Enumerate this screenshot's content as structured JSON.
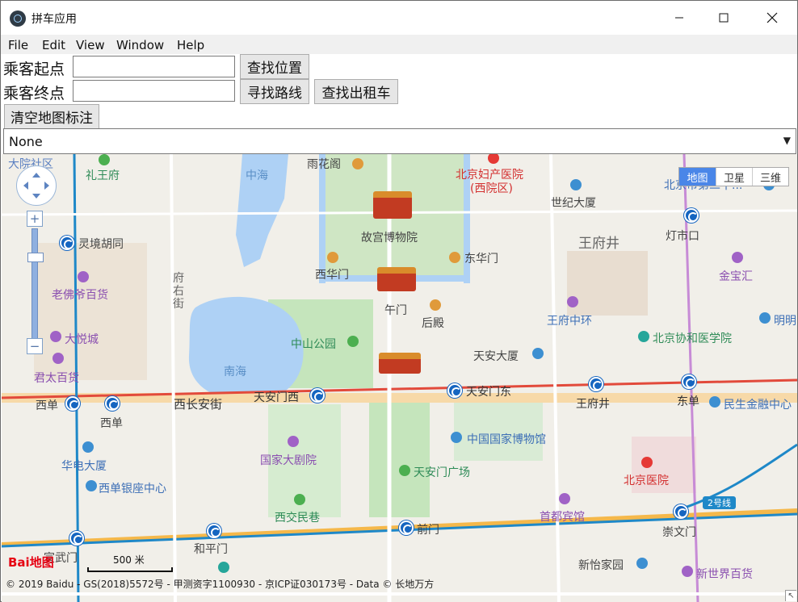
{
  "window": {
    "title": "拼车应用",
    "min_icon": "minimize-icon",
    "max_icon": "maximize-icon",
    "close_icon": "close-icon"
  },
  "menu": [
    "File",
    "Edit",
    "View",
    "Window",
    "Help"
  ],
  "form": {
    "start_label": "乘客起点",
    "start_value": "",
    "end_label": "乘客终点",
    "end_value": "",
    "find_location": "查找位置",
    "find_route": "寻找路线",
    "find_taxi": "查找出租车",
    "clear_markers": "清空地图标注",
    "select_value": "None"
  },
  "map": {
    "type_buttons": [
      "地图",
      "卫星",
      "三维"
    ],
    "active_type": "地图",
    "scale_label": "500 米",
    "logo_text": "Bai地图",
    "copyright": "© 2019 Baidu - GS(2018)5572号 - 甲测资字1100930 - 京ICP证030173号 - Data © 长地万方",
    "labels": {
      "dayuan": "大院社区",
      "liwangfu": "礼王府",
      "zhonghai": "中海",
      "yuhuage": "雨花阁",
      "fuchanyiyuan": "北京妇产医院",
      "fuchanyiyuan2": "(西院区)",
      "shijidasha": "世纪大厦",
      "beijingdi": "北京市第二十...",
      "lingjing": "灵境胡同",
      "gugong": "故宫博物院",
      "wangfujing_big": "王府井",
      "dengshikou": "灯市口",
      "xihuamen": "西华门",
      "donghuamen": "东华门",
      "jinbaohui": "金宝汇",
      "laofoye": "老佛爷百货",
      "fuyoujie": "府右街",
      "wumen": "午门",
      "houdian": "后殿",
      "wangfuzhonghuan": "王府中环",
      "mingming": "明明",
      "dayuecheng": "大悦城",
      "zhongshan": "中山公园",
      "xiehe": "北京协和医学院",
      "tiananmen_dasha": "天安大厦",
      "juntai": "君太百货",
      "nanhai": "南海",
      "xidan": "西单",
      "xichangan": "西长安街",
      "tiananmen_west": "天安门西",
      "tiananmen_east": "天安门东",
      "wangfujing": "王府井",
      "dongdan": "东单",
      "minsheng": "民生金融中心",
      "xidan2": "西单",
      "guojiabowuguan": "中国国家博物馆",
      "guojiadajuyuan": "国家大剧院",
      "tiananmen_sq": "天安门广场",
      "huadian": "华电大厦",
      "beijingyiyuan": "北京医院",
      "xidanyinzuo": "西单银座中心",
      "xijiaominxiang": "西交民巷",
      "shoudu": "首都宾馆",
      "line2": "2号线",
      "xuanwumen": "宣武门",
      "hepingmen": "和平门",
      "qianmen": "前门",
      "chongwenmen": "崇文门",
      "xinyi": "新怡家园",
      "xinshijie": "新世界百货"
    }
  },
  "colors": {
    "water": "#aed1f5",
    "park": "#c5e5bc",
    "road_main": "#f5a623",
    "metro_line": "#1e88c8",
    "purple_line": "#c78bd6"
  }
}
